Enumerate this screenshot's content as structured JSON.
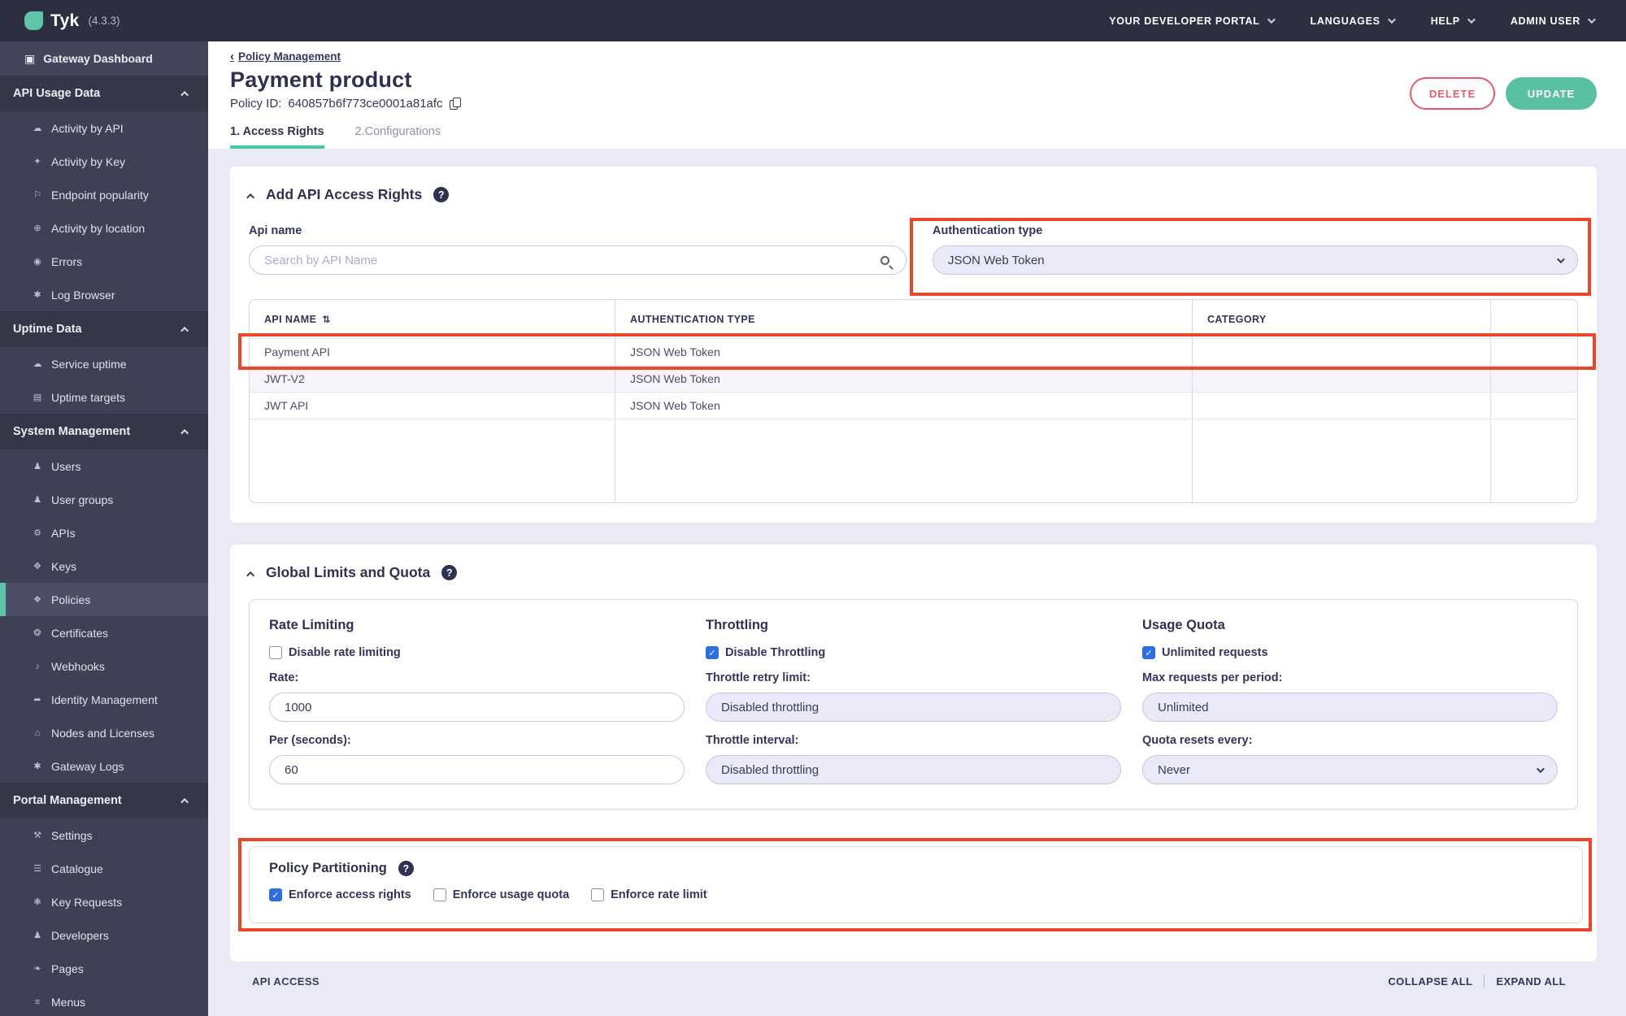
{
  "header": {
    "logo_text": "Tyk",
    "version": "(4.3.3)",
    "menus": [
      {
        "label": "YOUR DEVELOPER PORTAL"
      },
      {
        "label": "LANGUAGES"
      },
      {
        "label": "HELP"
      },
      {
        "label": "ADMIN USER"
      }
    ]
  },
  "sidebar": {
    "top_item": {
      "label": "Gateway Dashboard",
      "icon": "▣"
    },
    "sections": [
      {
        "label": "API Usage Data",
        "items": [
          {
            "label": "Activity by API",
            "icon": "☁"
          },
          {
            "label": "Activity by Key",
            "icon": "✦"
          },
          {
            "label": "Endpoint popularity",
            "icon": "⚐"
          },
          {
            "label": "Activity by location",
            "icon": "⊕"
          },
          {
            "label": "Errors",
            "icon": "◉"
          },
          {
            "label": "Log Browser",
            "icon": "✱"
          }
        ]
      },
      {
        "label": "Uptime Data",
        "items": [
          {
            "label": "Service uptime",
            "icon": "☁"
          },
          {
            "label": "Uptime targets",
            "icon": "▤"
          }
        ]
      },
      {
        "label": "System Management",
        "items": [
          {
            "label": "Users",
            "icon": "♟"
          },
          {
            "label": "User groups",
            "icon": "♟"
          },
          {
            "label": "APIs",
            "icon": "⚙"
          },
          {
            "label": "Keys",
            "icon": "✥"
          },
          {
            "label": "Policies",
            "icon": "❖"
          },
          {
            "label": "Certificates",
            "icon": "❂"
          },
          {
            "label": "Webhooks",
            "icon": "♪"
          },
          {
            "label": "Identity Management",
            "icon": "➦"
          },
          {
            "label": "Nodes and Licenses",
            "icon": "⌂"
          },
          {
            "label": "Gateway Logs",
            "icon": "✱"
          }
        ]
      },
      {
        "label": "Portal Management",
        "items": [
          {
            "label": "Settings",
            "icon": "⚒"
          },
          {
            "label": "Catalogue",
            "icon": "☰"
          },
          {
            "label": "Key Requests",
            "icon": "❃"
          },
          {
            "label": "Developers",
            "icon": "♟"
          },
          {
            "label": "Pages",
            "icon": "❧"
          },
          {
            "label": "Menus",
            "icon": "≡"
          }
        ]
      }
    ]
  },
  "page": {
    "breadcrumb_arrow": "‹",
    "breadcrumb": "Policy Management",
    "title": "Payment product",
    "policy_id_label": "Policy ID:",
    "policy_id": "640857b6f773ce0001a81afc",
    "delete_label": "DELETE",
    "update_label": "UPDATE",
    "tabs": [
      {
        "label": "1. Access Rights"
      },
      {
        "label": "2.Configurations"
      }
    ]
  },
  "access_rights": {
    "title": "Add API Access Rights",
    "api_name_label": "Api name",
    "search_placeholder": "Search by API Name",
    "auth_label": "Authentication type",
    "auth_value": "JSON Web Token",
    "table": {
      "columns": [
        "API NAME",
        "AUTHENTICATION TYPE",
        "CATEGORY"
      ],
      "sort_glyph": "⇅",
      "rows": [
        {
          "name": "Payment API",
          "auth": "JSON Web Token",
          "category": ""
        },
        {
          "name": "JWT-V2",
          "auth": "JSON Web Token",
          "category": ""
        },
        {
          "name": "JWT API",
          "auth": "JSON Web Token",
          "category": ""
        }
      ]
    }
  },
  "limits": {
    "title": "Global Limits and Quota",
    "rate": {
      "title": "Rate Limiting",
      "checkbox": "Disable rate limiting",
      "checked": false,
      "rate_label": "Rate:",
      "rate_value": "1000",
      "per_label": "Per (seconds):",
      "per_value": "60"
    },
    "throttle": {
      "title": "Throttling",
      "checkbox": "Disable Throttling",
      "checked": true,
      "retry_label": "Throttle retry limit:",
      "retry_value": "Disabled throttling",
      "interval_label": "Throttle interval:",
      "interval_value": "Disabled throttling"
    },
    "quota": {
      "title": "Usage Quota",
      "checkbox": "Unlimited requests",
      "checked": true,
      "max_label": "Max requests per period:",
      "max_value": "Unlimited",
      "resets_label": "Quota resets every:",
      "resets_value": "Never"
    }
  },
  "partitioning": {
    "title": "Policy Partitioning",
    "options": [
      {
        "label": "Enforce access rights",
        "checked": true
      },
      {
        "label": "Enforce usage quota",
        "checked": false
      },
      {
        "label": "Enforce rate limit",
        "checked": false
      }
    ]
  },
  "footer": {
    "left": "API ACCESS",
    "collapse": "COLLAPSE ALL",
    "expand": "EXPAND ALL"
  },
  "colors": {
    "annotation_red": "#e8472c",
    "accent_teal": "#5ac0a2",
    "delete_red": "#e45a68",
    "checkbox_blue": "#2b6fe3"
  }
}
